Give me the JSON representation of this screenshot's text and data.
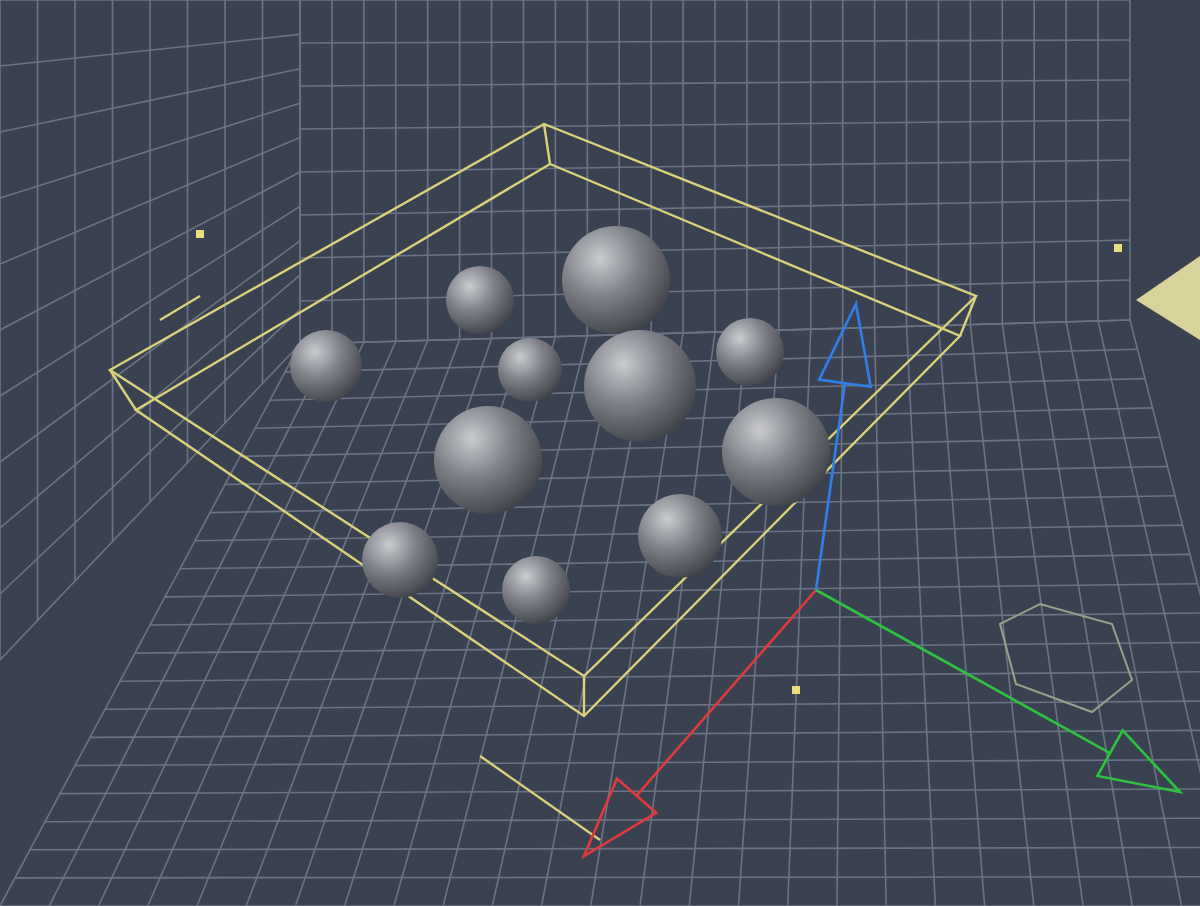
{
  "viewport": {
    "gizmo": {
      "axes": [
        {
          "kind": "x",
          "color": "#e03a3a"
        },
        {
          "kind": "y",
          "color": "#2fc23f"
        },
        {
          "kind": "z",
          "color": "#2f7fe8"
        }
      ]
    }
  }
}
